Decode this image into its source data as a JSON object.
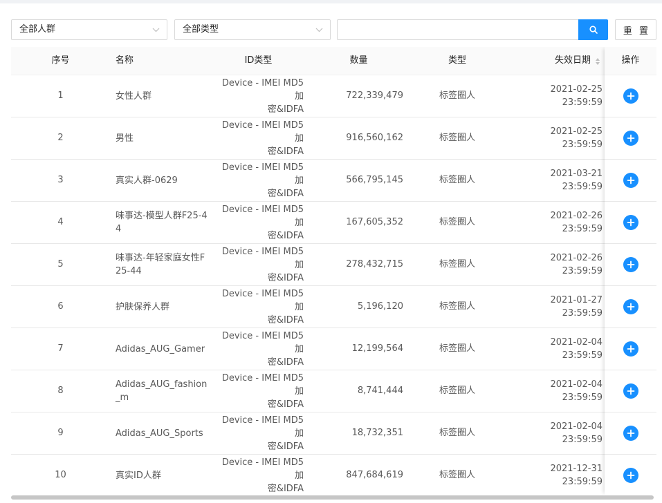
{
  "filters": {
    "audience_select": "全部人群",
    "type_select": "全部类型",
    "search_value": "",
    "reset_label": "重 置"
  },
  "table": {
    "headers": {
      "index": "序号",
      "name": "名称",
      "id_type": "ID类型",
      "count": "数量",
      "type": "类型",
      "expire": "失效日期",
      "action": "操作"
    },
    "rows": [
      {
        "index": "1",
        "name": "女性人群",
        "id_type_l1": "Device - IMEI MD5加",
        "id_type_l2": "密&IDFA",
        "count": "722,339,479",
        "type": "标签圈人",
        "date": "2021-02-25",
        "time": "23:59:59"
      },
      {
        "index": "2",
        "name": "男性",
        "id_type_l1": "Device - IMEI MD5加",
        "id_type_l2": "密&IDFA",
        "count": "916,560,162",
        "type": "标签圈人",
        "date": "2021-02-25",
        "time": "23:59:59"
      },
      {
        "index": "3",
        "name": "真实人群-0629",
        "id_type_l1": "Device - IMEI MD5加",
        "id_type_l2": "密&IDFA",
        "count": "566,795,145",
        "type": "标签圈人",
        "date": "2021-03-21",
        "time": "23:59:59"
      },
      {
        "index": "4",
        "name": "味事达-模型人群F25-44",
        "id_type_l1": "Device - IMEI MD5加",
        "id_type_l2": "密&IDFA",
        "count": "167,605,352",
        "type": "标签圈人",
        "date": "2021-02-26",
        "time": "23:59:59"
      },
      {
        "index": "5",
        "name": "味事达-年轻家庭女性F25-44",
        "id_type_l1": "Device - IMEI MD5加",
        "id_type_l2": "密&IDFA",
        "count": "278,432,715",
        "type": "标签圈人",
        "date": "2021-02-26",
        "time": "23:59:59"
      },
      {
        "index": "6",
        "name": "护肤保养人群",
        "id_type_l1": "Device - IMEI MD5加",
        "id_type_l2": "密&IDFA",
        "count": "5,196,120",
        "type": "标签圈人",
        "date": "2021-01-27",
        "time": "23:59:59"
      },
      {
        "index": "7",
        "name": "Adidas_AUG_Gamer",
        "id_type_l1": "Device - IMEI MD5加",
        "id_type_l2": "密&IDFA",
        "count": "12,199,564",
        "type": "标签圈人",
        "date": "2021-02-04",
        "time": "23:59:59"
      },
      {
        "index": "8",
        "name": "Adidas_AUG_fashion_m",
        "id_type_l1": "Device - IMEI MD5加",
        "id_type_l2": "密&IDFA",
        "count": "8,741,444",
        "type": "标签圈人",
        "date": "2021-02-04",
        "time": "23:59:59"
      },
      {
        "index": "9",
        "name": "Adidas_AUG_Sports",
        "id_type_l1": "Device - IMEI MD5加",
        "id_type_l2": "密&IDFA",
        "count": "18,732,351",
        "type": "标签圈人",
        "date": "2021-02-04",
        "time": "23:59:59"
      },
      {
        "index": "10",
        "name": "真实ID人群",
        "id_type_l1": "Device - IMEI MD5加",
        "id_type_l2": "密&IDFA",
        "count": "847,684,619",
        "type": "标签圈人",
        "date": "2021-12-31",
        "time": "23:59:59"
      }
    ]
  },
  "icons": {
    "search": "search-icon",
    "add": "plus-circle-icon",
    "chevron": "chevron-down-icon",
    "sort": "sort-icon"
  },
  "colors": {
    "primary": "#1890ff",
    "header_bg": "#fafafa",
    "border": "#d9d9d9"
  }
}
